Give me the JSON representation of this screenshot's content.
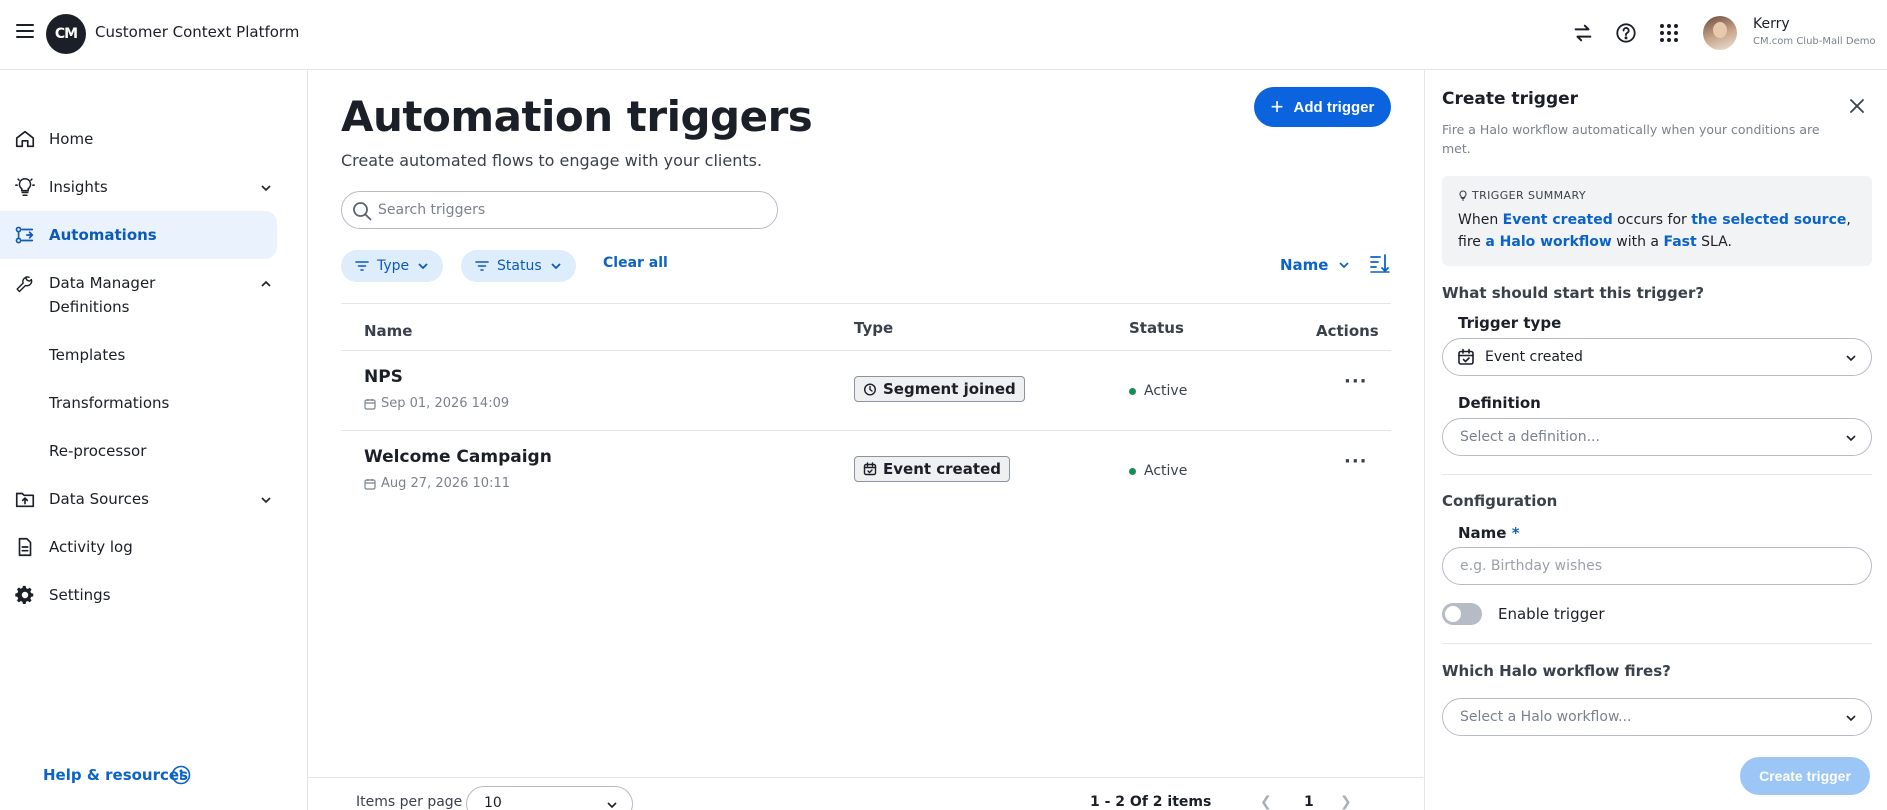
{
  "header": {
    "logo": "CM",
    "app_title": "Customer Context Platform",
    "user_name": "Kerry",
    "user_org": "CM.com Club-Mall Demo"
  },
  "sidebar": {
    "items": [
      {
        "label": "Home",
        "icon": "home-icon"
      },
      {
        "label": "Insights",
        "icon": "lightbulb-icon"
      },
      {
        "label": "Automations",
        "icon": "automation-icon"
      },
      {
        "label": "Data Manager",
        "icon": "wrench-icon"
      },
      {
        "label": "Data Sources",
        "icon": "upload-folder-icon"
      },
      {
        "label": "Activity log",
        "icon": "document-icon"
      },
      {
        "label": "Settings",
        "icon": "gear-icon"
      }
    ],
    "sub_items": [
      "Definitions",
      "Templates",
      "Transformations",
      "Re-processor"
    ],
    "help_label": "Help & resources"
  },
  "main": {
    "title": "Automation triggers",
    "subtitle": "Create automated flows to engage with your clients.",
    "add_button": "Add trigger",
    "search_placeholder": "Search triggers",
    "filters": [
      "Type",
      "Status"
    ],
    "clear_all": "Clear all",
    "sort_label": "Name",
    "columns": [
      "Name",
      "Type",
      "Status",
      "Actions"
    ],
    "rows": [
      {
        "name": "NPS",
        "date": "Sep 01, 2026 14:09",
        "type": "Segment joined",
        "status": "Active"
      },
      {
        "name": "Welcome Campaign",
        "date": "Aug 27, 2026 10:11",
        "type": "Event created",
        "status": "Active"
      }
    ],
    "footer": {
      "items_per_page_label": "Items per page",
      "items_per_page_value": "10",
      "range_text": "1 - 2 Of 2 items",
      "current_page": "1"
    }
  },
  "panel": {
    "title": "Create trigger",
    "description": "Fire a Halo workflow automatically when your conditions are met.",
    "summary_heading": "TRIGGER SUMMARY",
    "summary": {
      "p1": "When ",
      "event": "Event created",
      "p2": " occurs for ",
      "source": "the selected source",
      "p3": ", fire ",
      "workflow": "a Halo workflow",
      "p4": " with a ",
      "sla": "Fast",
      "p5": " SLA."
    },
    "q_start": "What should start this trigger?",
    "trigger_type_label": "Trigger type",
    "trigger_type_value": "Event created",
    "definition_label": "Definition",
    "definition_placeholder": "Select a definition...",
    "configuration_label": "Configuration",
    "name_label": "Name",
    "name_required": "*",
    "name_placeholder": "e.g. Birthday wishes",
    "enable_label": "Enable trigger",
    "q_workflow": "Which Halo workflow fires?",
    "workflow_placeholder": "Select a Halo workflow...",
    "create_button": "Create trigger"
  },
  "colors": {
    "accent": "#0b63dd",
    "active_nav_bg": "#eaf3fd",
    "status_active": "#1a8a5a"
  }
}
